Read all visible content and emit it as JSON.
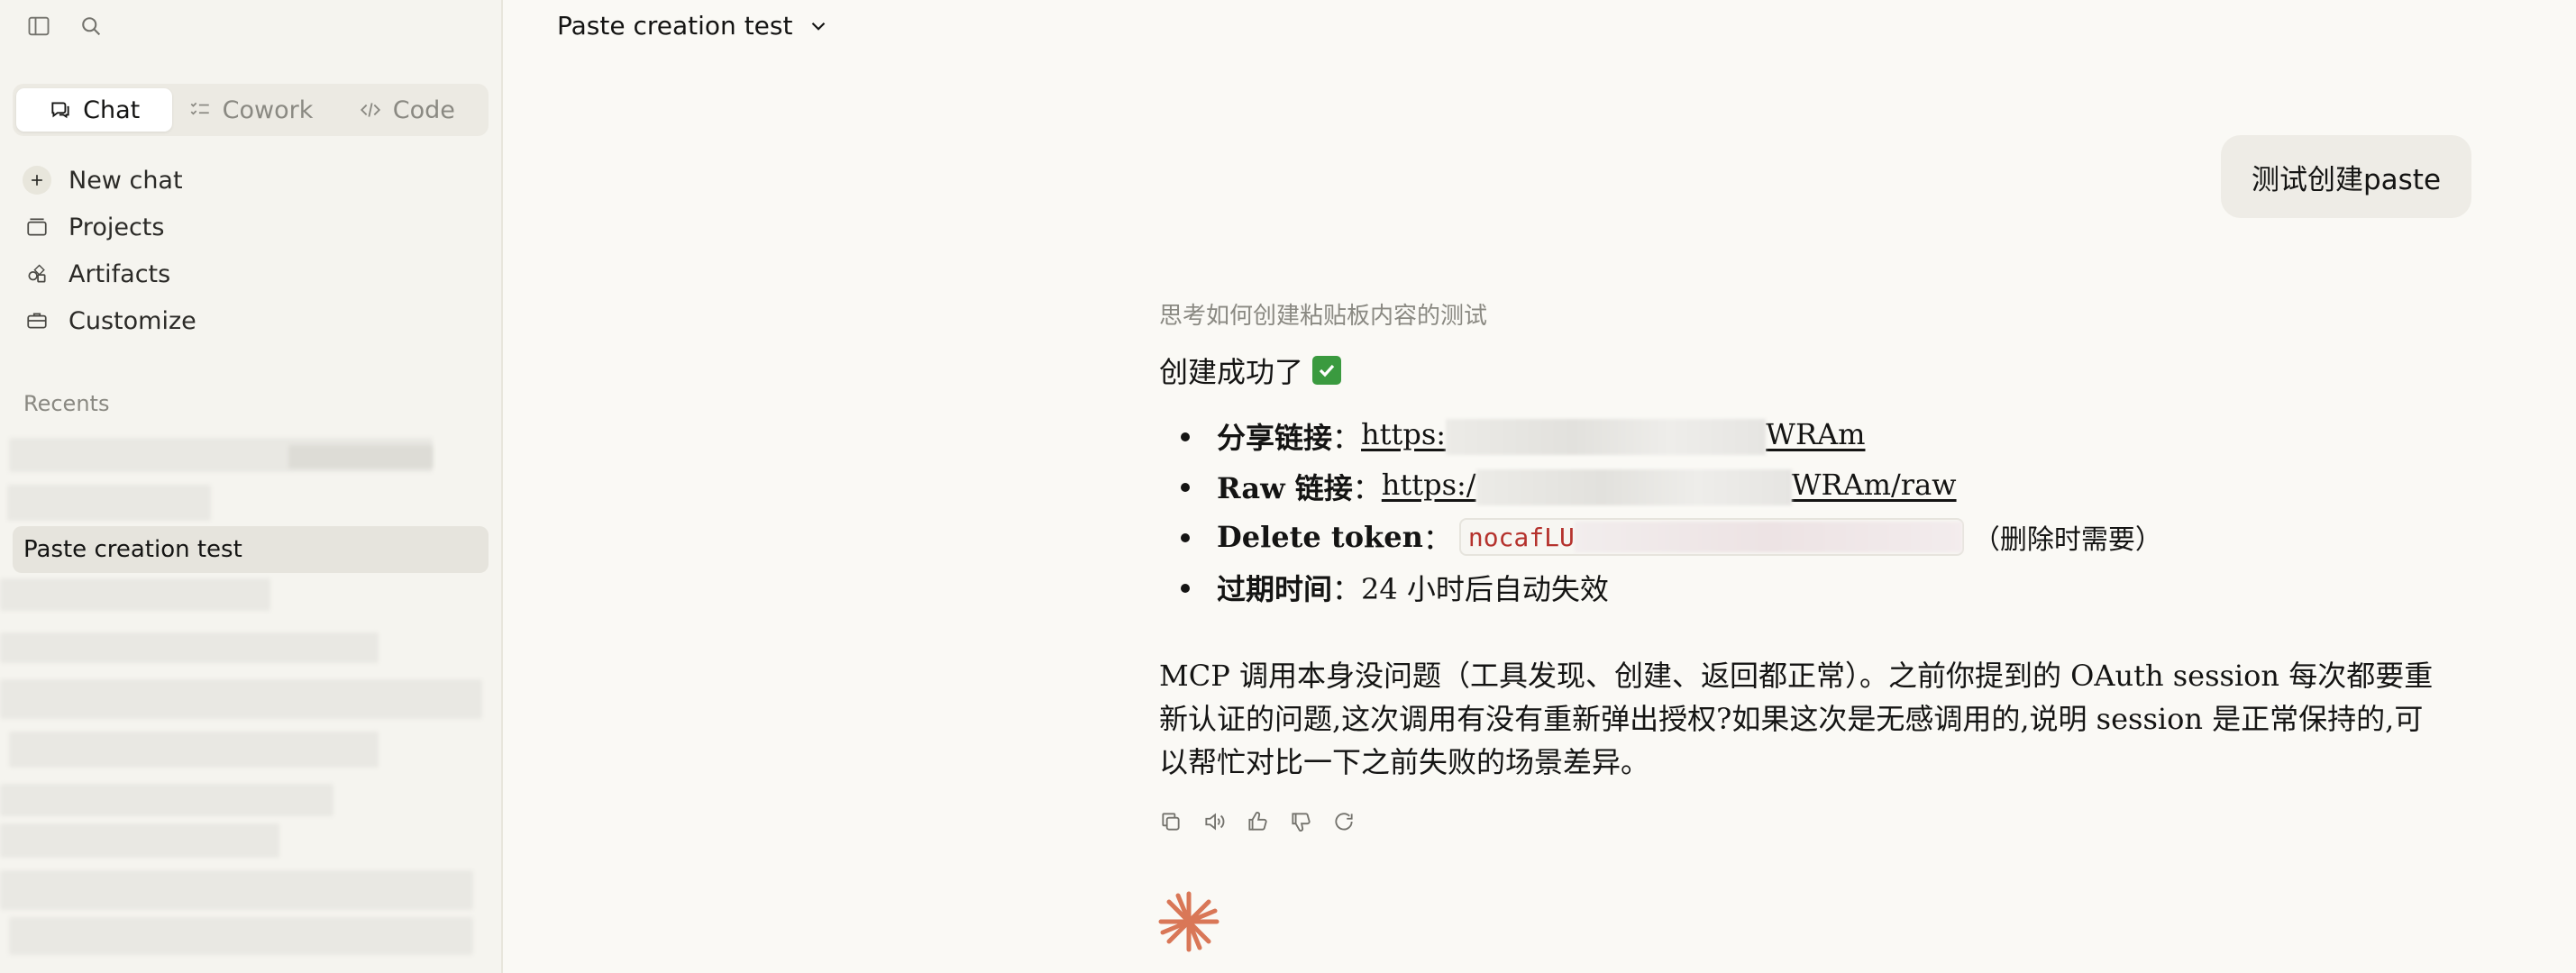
{
  "sidebar": {
    "modes": [
      {
        "label": "Chat",
        "active": true
      },
      {
        "label": "Cowork",
        "active": false
      },
      {
        "label": "Code",
        "active": false
      }
    ],
    "nav": [
      {
        "label": "New chat",
        "icon": "plus-icon"
      },
      {
        "label": "Projects",
        "icon": "folder-icon"
      },
      {
        "label": "Artifacts",
        "icon": "artifacts-icon"
      },
      {
        "label": "Customize",
        "icon": "briefcase-icon"
      }
    ],
    "recents_label": "Recents",
    "active_recent": "Paste creation test"
  },
  "main": {
    "title": "Paste creation test",
    "user_message": "测试创建paste",
    "thinking": "思考如何创建粘贴板内容的测试",
    "lead": "创建成功了",
    "items": [
      {
        "label": "分享链接",
        "sep": "：",
        "value_start": "https:",
        "value_end": "WRAm"
      },
      {
        "label": "Raw 链接",
        "sep": "：",
        "value_start": "https:/",
        "value_end": "WRAm/raw"
      },
      {
        "label": "Delete token",
        "sep": "：",
        "value_start": "nocafLU",
        "note": "（删除时需要）"
      },
      {
        "label": "过期时间",
        "sep": "：",
        "value": "24 小时后自动失效"
      }
    ],
    "paragraph": "MCP 调用本身没问题（工具发现、创建、返回都正常）。之前你提到的 OAuth session 每次都要重新认证的问题,这次调用有没有重新弹出授权?如果这次是无感调用的,说明 session 是正常保持的,可以帮忙对比一下之前失败的场景差异。"
  },
  "colors": {
    "accent": "#d97757",
    "code_text": "#b5322d",
    "background": "#faf9f5",
    "sidebar": "#f5f4ef"
  }
}
